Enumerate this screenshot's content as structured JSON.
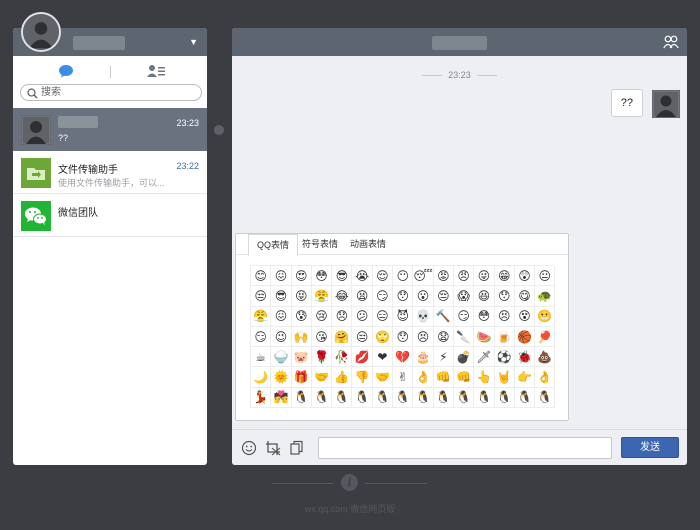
{
  "left_panel": {
    "search": {
      "placeholder": "搜索"
    },
    "conversations": [
      {
        "name": "",
        "time": "23:23",
        "preview": "??"
      },
      {
        "name": "文件传输助手",
        "time": "23:22",
        "preview": "使用文件传输助手，可以..."
      },
      {
        "name": "微信团队",
        "time": "",
        "preview": ""
      }
    ]
  },
  "chat": {
    "time_divider": "23:23",
    "messages": [
      {
        "text": "??",
        "from": "self"
      }
    ],
    "emoji_tabs": [
      "QQ表情",
      "符号表情",
      "动画表情"
    ],
    "emoji_grid": [
      "😊",
      "😖",
      "😍",
      "😳",
      "😎",
      "😭",
      "😌",
      "😶",
      "😴",
      "😡",
      "😠",
      "😜",
      "😁",
      "😲",
      "😐",
      "😒",
      "😎",
      "😝",
      "😤",
      "😂",
      "😫",
      "😏",
      "😯",
      "😮",
      "😔",
      "😱",
      "😆",
      "😯",
      "😋",
      "🐢",
      "😤",
      "😖",
      "😰",
      "😢",
      "😞",
      "😕",
      "😑",
      "😈",
      "💀",
      "🔨",
      "😏",
      "😳",
      "😣",
      "😵",
      "😬",
      "😏",
      "😉",
      "🙌",
      "😘",
      "🤗",
      "😒",
      "🙄",
      "😯",
      "😣",
      "😧",
      "🔪",
      "🍉",
      "🍺",
      "🏀",
      "🏓",
      "☕",
      "🍚",
      "🐷",
      "🌹",
      "🥀",
      "💋",
      "❤",
      "💔",
      "🎂",
      "⚡",
      "💣",
      "🗡",
      "⚽",
      "🐞",
      "💩",
      "🌙",
      "🌞",
      "🎁",
      "🤝",
      "👍",
      "👎",
      "🤝",
      "✌",
      "👌",
      "👊",
      "👊",
      "👆",
      "🤘",
      "👉",
      "👌",
      "💃",
      "💏",
      "🐧",
      "🐧",
      "🐧",
      "🐧",
      "🐧",
      "🐧",
      "🐧",
      "🐧",
      "🐧",
      "🐧",
      "🐧",
      "🐧",
      "🐧"
    ],
    "send_label": "发送"
  },
  "footer": {
    "text": "wx.qq.com  微信网页版"
  },
  "colors": {
    "header": "#5c6570",
    "active_row": "#69727e",
    "send_button": "#3d66b0",
    "background": "#3b3d42"
  }
}
